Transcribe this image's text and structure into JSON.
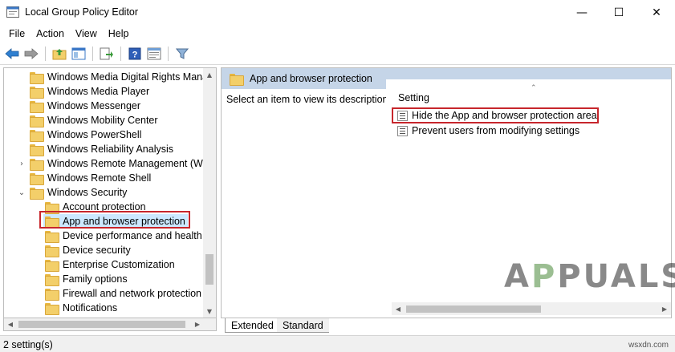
{
  "window": {
    "title": "Local Group Policy Editor",
    "controls": {
      "minimize": "—",
      "maximize": "☐",
      "close": "✕"
    }
  },
  "menu": [
    "File",
    "Action",
    "View",
    "Help"
  ],
  "toolbar": {
    "icons": [
      "back-arrow-icon",
      "forward-arrow-icon",
      "folder-up-icon",
      "show-hide-tree-icon",
      "export-list-icon",
      "help-icon",
      "properties-icon",
      "filter-icon"
    ]
  },
  "tree": {
    "items": [
      {
        "label": "Windows Media Digital Rights Manag",
        "level": 1,
        "expander": ""
      },
      {
        "label": "Windows Media Player",
        "level": 1,
        "expander": ""
      },
      {
        "label": "Windows Messenger",
        "level": 1,
        "expander": ""
      },
      {
        "label": "Windows Mobility Center",
        "level": 1,
        "expander": ""
      },
      {
        "label": "Windows PowerShell",
        "level": 1,
        "expander": ""
      },
      {
        "label": "Windows Reliability Analysis",
        "level": 1,
        "expander": ""
      },
      {
        "label": "Windows Remote Management (Win",
        "level": 1,
        "expander": "›"
      },
      {
        "label": "Windows Remote Shell",
        "level": 1,
        "expander": ""
      },
      {
        "label": "Windows Security",
        "level": 1,
        "expander": "⌄"
      },
      {
        "label": "Account protection",
        "level": 2,
        "expander": ""
      },
      {
        "label": "App and browser protection",
        "level": 2,
        "expander": "",
        "selected": true
      },
      {
        "label": "Device performance and health",
        "level": 2,
        "expander": ""
      },
      {
        "label": "Device security",
        "level": 2,
        "expander": ""
      },
      {
        "label": "Enterprise Customization",
        "level": 2,
        "expander": ""
      },
      {
        "label": "Family options",
        "level": 2,
        "expander": ""
      },
      {
        "label": "Firewall and network protection",
        "level": 2,
        "expander": ""
      },
      {
        "label": "Notifications",
        "level": 2,
        "expander": ""
      }
    ]
  },
  "right": {
    "header_title": "App and browser protection",
    "description": "Select an item to view its description.",
    "column_header": "Setting",
    "settings": [
      {
        "label": "Hide the App and browser protection area",
        "highlighted": true
      },
      {
        "label": "Prevent users from modifying settings",
        "highlighted": false
      }
    ]
  },
  "tabs": [
    "Extended",
    "Standard"
  ],
  "status": "2 setting(s)",
  "watermark": {
    "logo": "APPUALS",
    "site": "wsxdn.com"
  },
  "colors": {
    "highlight": "#c7262c",
    "selection": "#cce8ff",
    "header_bg": "#c5d5e8"
  }
}
